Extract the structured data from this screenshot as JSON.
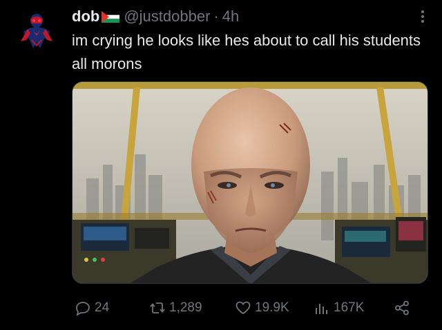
{
  "tweet": {
    "author": {
      "display_name": "dob",
      "handle": "@justdobber",
      "flag_icon": "palestine-flag-icon",
      "avatar_icon": "spiderman-2099-avatar"
    },
    "separator": "·",
    "time": "4h",
    "text": "im crying he looks like hes about to call his students all morons",
    "media": {
      "description_icon": "bald-man-control-room-photo"
    },
    "actions": {
      "reply_count": "24",
      "retweet_count": "1,289",
      "like_count": "19.9K",
      "view_count": "167K"
    }
  },
  "colors": {
    "background": "#000000",
    "primary_text": "#e7e9ea",
    "secondary_text": "#71767b",
    "border": "#2f3336"
  }
}
